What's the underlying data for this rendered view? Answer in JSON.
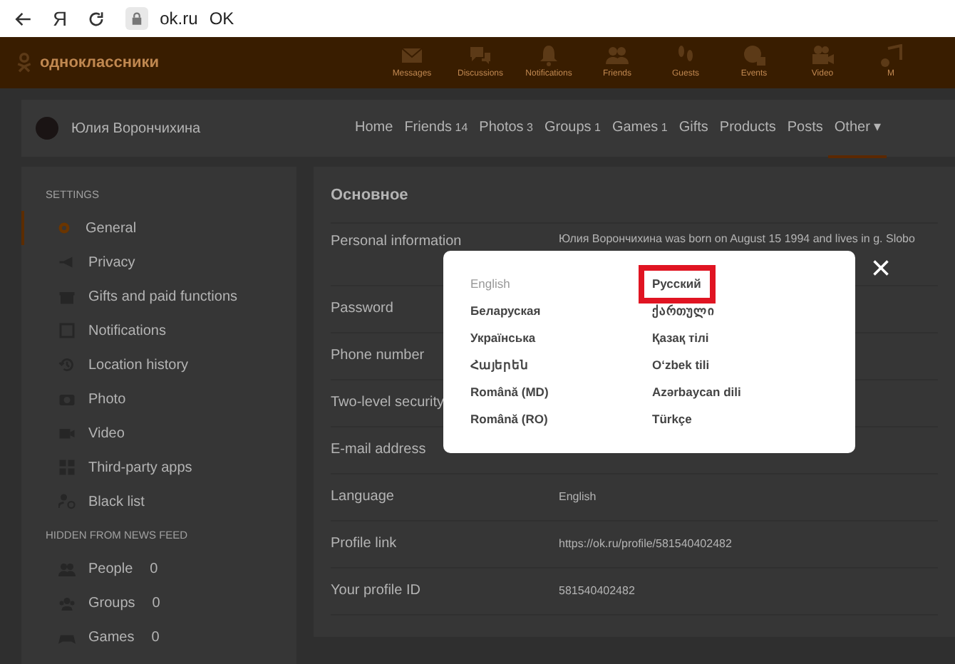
{
  "browser": {
    "url": "ok.ru",
    "page_title": "OK",
    "yandex_button": "Я"
  },
  "header": {
    "logo": "одноклассники",
    "items": [
      {
        "label": "Messages"
      },
      {
        "label": "Discussions"
      },
      {
        "label": "Notifications"
      },
      {
        "label": "Friends"
      },
      {
        "label": "Guests"
      },
      {
        "label": "Events"
      },
      {
        "label": "Video"
      },
      {
        "label": "M"
      }
    ]
  },
  "profile": {
    "name": "Юлия Ворончихина",
    "tabs": [
      {
        "label": "Home",
        "selected": false
      },
      {
        "label": "Friends",
        "count": "14",
        "selected": false
      },
      {
        "label": "Photos",
        "count": "3",
        "selected": false
      },
      {
        "label": "Groups",
        "count": "1",
        "selected": false
      },
      {
        "label": "Games",
        "count": "1",
        "selected": false
      },
      {
        "label": "Gifts",
        "selected": false
      },
      {
        "label": "Products",
        "selected": false
      },
      {
        "label": "Posts",
        "selected": false
      },
      {
        "label": "Other",
        "caret": "▾",
        "selected": true
      }
    ]
  },
  "sidebar": {
    "sections": [
      {
        "heading": "SETTINGS",
        "items": [
          {
            "label": "General",
            "selected": true
          },
          {
            "label": "Privacy",
            "selected": false
          },
          {
            "label": "Gifts and paid functions",
            "selected": false
          },
          {
            "label": "Notifications",
            "selected": false
          },
          {
            "label": "Location history",
            "selected": false
          },
          {
            "label": "Photo",
            "selected": false
          },
          {
            "label": "Video",
            "selected": false
          },
          {
            "label": "Third-party apps",
            "selected": false
          },
          {
            "label": "Black list",
            "selected": false
          }
        ]
      },
      {
        "heading": "HIDDEN FROM NEWS FEED",
        "items": [
          {
            "label": "People",
            "count": "0",
            "selected": false
          },
          {
            "label": "Groups",
            "count": "0",
            "selected": false
          },
          {
            "label": "Games",
            "count": "0",
            "selected": false
          }
        ]
      }
    ]
  },
  "settings": {
    "title": "Основное",
    "rows": [
      {
        "label": "Personal information",
        "value": "Юлия Ворончихина was born on August 15 1994 and lives in g. Slobo"
      },
      {
        "label": "Password"
      },
      {
        "label": "Phone number"
      },
      {
        "label": "Two-level security"
      },
      {
        "label": "E-mail address"
      },
      {
        "label": "Language",
        "value": "English"
      },
      {
        "label": "Profile link",
        "value": "https://ok.ru/profile/581540402482"
      },
      {
        "label": "Your profile ID",
        "value": "581540402482"
      }
    ]
  },
  "language_dialog": {
    "close": "×",
    "columns": [
      [
        {
          "label": "English",
          "selected": true,
          "highlighted": false
        },
        {
          "label": "Беларуская",
          "selected": false,
          "highlighted": false
        },
        {
          "label": "Українська",
          "selected": false,
          "highlighted": false
        },
        {
          "label": "Հայերեն",
          "selected": false,
          "highlighted": false
        },
        {
          "label": "Română (MD)",
          "selected": false,
          "highlighted": false
        },
        {
          "label": "Română (RO)",
          "selected": false,
          "highlighted": false
        }
      ],
      [
        {
          "label": "Русский",
          "selected": false,
          "highlighted": true
        },
        {
          "label": "ქართული",
          "selected": false,
          "highlighted": false
        },
        {
          "label": "Қазақ тілі",
          "selected": false,
          "highlighted": false
        },
        {
          "label": "O‘zbek tili",
          "selected": false,
          "highlighted": false
        },
        {
          "label": "Azərbaycan dili",
          "selected": false,
          "highlighted": false
        },
        {
          "label": "Türkçe",
          "selected": false,
          "highlighted": false
        }
      ]
    ]
  }
}
